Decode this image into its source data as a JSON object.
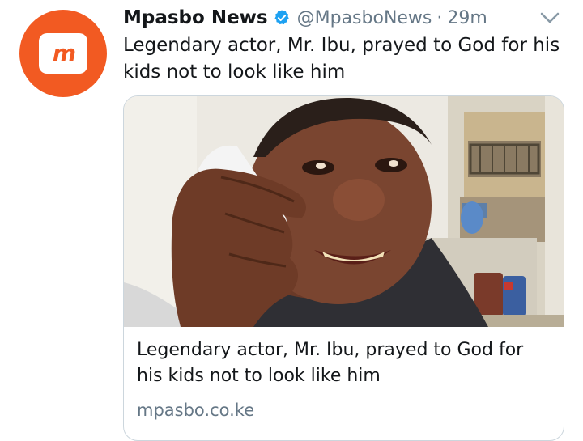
{
  "tweet": {
    "avatar_text": "m",
    "name": "Mpasbo News",
    "handle": "@MpasboNews",
    "separator": "·",
    "time": "29m",
    "text": "Legendary actor, Mr. Ibu, prayed to God for his kids not to look like him",
    "verified_color": "#1da1f2"
  },
  "card": {
    "title": "Legendary actor, Mr. Ibu, prayed to God for his kids not to look like him",
    "link": "mpasbo.co.ke"
  },
  "icons": {
    "verified": "verified-badge-icon",
    "menu": "chevron-down-icon"
  },
  "colors": {
    "brand": "#f25a22",
    "secondary_text": "#657786",
    "border": "#ccd6dd"
  }
}
